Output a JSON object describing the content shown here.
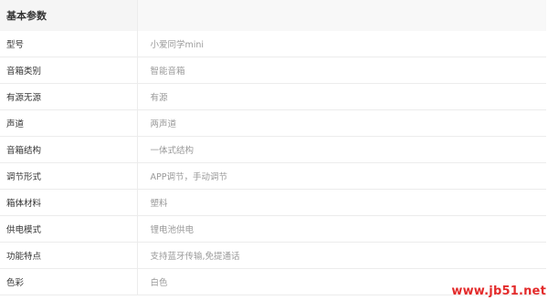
{
  "section_title": "基本参数",
  "specs": [
    {
      "label": "型号",
      "value": "小爱同学mini"
    },
    {
      "label": "音箱类别",
      "value": "智能音箱"
    },
    {
      "label": "有源无源",
      "value": "有源"
    },
    {
      "label": "声道",
      "value": "两声道"
    },
    {
      "label": "音箱结构",
      "value": "一体式结构"
    },
    {
      "label": "调节形式",
      "value": "APP调节，手动调节"
    },
    {
      "label": "箱体材料",
      "value": "塑料"
    },
    {
      "label": "供电模式",
      "value": "锂电池供电"
    },
    {
      "label": "功能特点",
      "value": "支持蓝牙传输,免提通话"
    },
    {
      "label": "色彩",
      "value": "白色"
    }
  ],
  "watermark": "www.jb51.net",
  "colors": {
    "header_bg": "#f5f5f5",
    "label_text": "#333333",
    "value_text": "#999999",
    "divider": "#ececec",
    "watermark": "#e32b2b"
  }
}
